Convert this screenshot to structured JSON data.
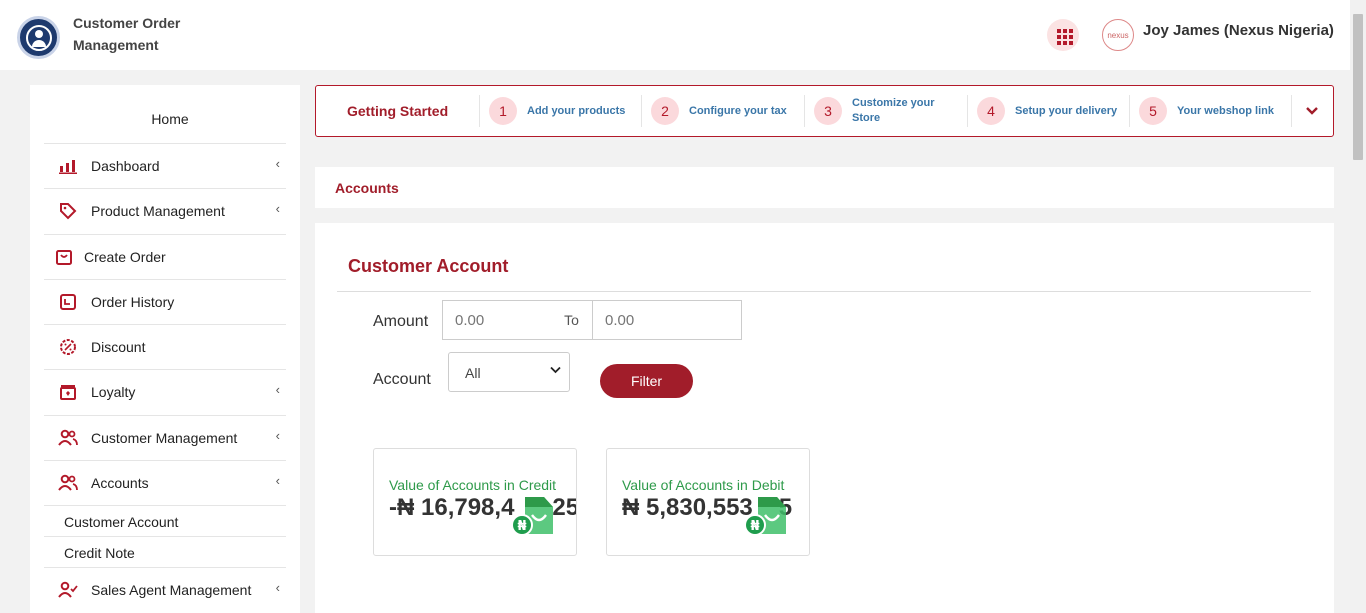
{
  "app": {
    "title": "Customer Order Management"
  },
  "header": {
    "user_name": "Joy James (Nexus Nigeria)",
    "avatar_text": "nexus"
  },
  "sidebar": {
    "home": "Home",
    "items": [
      {
        "label": "Dashboard",
        "icon": "bar-chart-icon",
        "has_chevron": true
      },
      {
        "label": "Product Management",
        "icon": "tag-icon",
        "has_chevron": true
      },
      {
        "label": "Create Order",
        "icon": "bag-icon",
        "has_chevron": false
      },
      {
        "label": "Order History",
        "icon": "history-icon",
        "has_chevron": false
      },
      {
        "label": "Discount",
        "icon": "discount-icon",
        "has_chevron": false
      },
      {
        "label": "Loyalty",
        "icon": "gift-icon",
        "has_chevron": true
      },
      {
        "label": "Customer Management",
        "icon": "users-icon",
        "has_chevron": true
      },
      {
        "label": "Accounts",
        "icon": "users-icon",
        "has_chevron": true
      },
      {
        "label": "Sales Agent Management",
        "icon": "user-check-icon",
        "has_chevron": true
      }
    ],
    "sub_items": [
      "Customer Account",
      "Credit Note"
    ],
    "chevron": "‹"
  },
  "getting_started": {
    "title": "Getting Started",
    "steps": [
      {
        "num": "1",
        "label": "Add your products"
      },
      {
        "num": "2",
        "label": "Configure your tax"
      },
      {
        "num": "3",
        "label": "Customize your Store"
      },
      {
        "num": "4",
        "label": "Setup your delivery"
      },
      {
        "num": "5",
        "label": "Your webshop link"
      }
    ]
  },
  "page": {
    "section_title": "Accounts"
  },
  "customer_account": {
    "title": "Customer Account",
    "amount_label": "Amount",
    "amount_from_placeholder": "0.00",
    "to_label": "To",
    "amount_to_placeholder": "0.00",
    "account_label": "Account",
    "account_selected": "All",
    "filter_label": "Filter",
    "cards": [
      {
        "label": "Value of Accounts in Credit",
        "value": "-₦ 16,798,4",
        "value_tail": "25"
      },
      {
        "label": "Value of Accounts in Debit",
        "value": "₦ 5,830,553",
        "value_tail": "5"
      }
    ]
  },
  "colors": {
    "brand": "#a11d2a",
    "link": "#3a76a8",
    "positive": "#2e9a4a"
  }
}
